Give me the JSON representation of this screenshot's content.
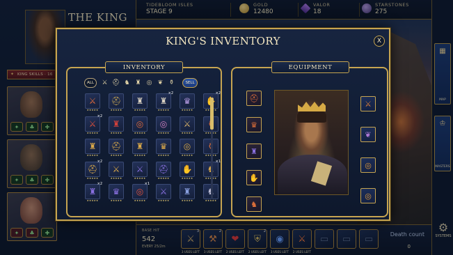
{
  "top_bar": {
    "region_label": "TIDEBLOOM ISLES",
    "stage": "STAGE 9",
    "gold_label": "GOLD",
    "gold_value": "12480",
    "valor_label": "VALOR",
    "valor_value": "18",
    "starstones_label": "STARSTONES",
    "starstones_value": "275"
  },
  "left_panel": {
    "title": "THE KING",
    "skills_tab": "KING SKILLS · 16"
  },
  "modal": {
    "title": "KING'S INVENTORY",
    "close_glyph": "X",
    "inventory_header": "INVENTORY",
    "equipment_header": "EQUIPMENT",
    "filter_all": "ALL",
    "filter_sell": "SELL",
    "filter_icons": [
      "sword-icon",
      "helmet-icon",
      "boots-icon",
      "armor-icon",
      "ring-icon",
      "amulet-icon",
      "potion-icon"
    ],
    "inventory_items": [
      {
        "icon": "sword-icon",
        "glyph": "⚔",
        "color": "#e06a3a",
        "qty": "",
        "stars": "★★★★★"
      },
      {
        "icon": "helmet-icon",
        "glyph": "⛑",
        "color": "#c7a551",
        "qty": "",
        "stars": "★★★★★"
      },
      {
        "icon": "armor-icon",
        "glyph": "♜",
        "color": "#d8d0c0",
        "qty": "",
        "stars": "★★★★★"
      },
      {
        "icon": "armor-icon",
        "glyph": "♜",
        "color": "#d8d0c0",
        "qty": "2",
        "stars": "★★★★★"
      },
      {
        "icon": "chestplate-icon",
        "glyph": "♛",
        "color": "#b49ae0",
        "qty": "",
        "stars": "★★★★★"
      },
      {
        "icon": "gauntlet-icon",
        "glyph": "✋",
        "color": "#d8d0c0",
        "qty": "2",
        "stars": "★★★★★"
      },
      {
        "icon": "sword-icon",
        "glyph": "⚔",
        "color": "#e0503a",
        "qty": "2",
        "stars": "★★★★★"
      },
      {
        "icon": "armor-icon",
        "glyph": "♜",
        "color": "#d0403a",
        "qty": "",
        "stars": "★★★★★"
      },
      {
        "icon": "ring-icon",
        "glyph": "◎",
        "color": "#e06a3a",
        "qty": "",
        "stars": "★★★★★"
      },
      {
        "icon": "ring-icon",
        "glyph": "◎",
        "color": "#d080c0",
        "qty": "",
        "stars": "★★★★★"
      },
      {
        "icon": "sword-icon",
        "glyph": "⚔",
        "color": "#d9b36a",
        "qty": "",
        "stars": "★★★★★"
      },
      {
        "icon": "potion-icon",
        "glyph": "⚱",
        "color": "#e0703a",
        "qty": "",
        "stars": "★★★★★"
      },
      {
        "icon": "armor-icon",
        "glyph": "♜",
        "color": "#d9a84a",
        "qty": "",
        "stars": "★★★★★"
      },
      {
        "icon": "helmet-icon",
        "glyph": "⛑",
        "color": "#d9a84a",
        "qty": "",
        "stars": "★★★★★"
      },
      {
        "icon": "armor-icon",
        "glyph": "♜",
        "color": "#d9a84a",
        "qty": "",
        "stars": "★★★★★"
      },
      {
        "icon": "chestplate-icon",
        "glyph": "♛",
        "color": "#d9a84a",
        "qty": "",
        "stars": "★★★★★"
      },
      {
        "icon": "ring-icon",
        "glyph": "◎",
        "color": "#d9a84a",
        "qty": "",
        "stars": "★★★★★"
      },
      {
        "icon": "potion-icon",
        "glyph": "⚱",
        "color": "#e0703a",
        "qty": "",
        "stars": "★★★★★"
      },
      {
        "icon": "helmet-icon",
        "glyph": "⛑",
        "color": "#d9a84a",
        "qty": "2",
        "stars": "★★★★★"
      },
      {
        "icon": "sword-icon",
        "glyph": "⚔",
        "color": "#d9a84a",
        "qty": "",
        "stars": "★★★★★"
      },
      {
        "icon": "sword-icon",
        "glyph": "⚔",
        "color": "#8a70e0",
        "qty": "",
        "stars": "★★★★★"
      },
      {
        "icon": "helmet-icon",
        "glyph": "⛑",
        "color": "#8a70e0",
        "qty": "",
        "stars": "★★★★★"
      },
      {
        "icon": "gauntlet-icon",
        "glyph": "✋",
        "color": "#e0a04a",
        "qty": "",
        "stars": "★★★★★"
      },
      {
        "icon": "boots-icon",
        "glyph": "♞",
        "color": "#d9a84a",
        "qty": "1",
        "stars": "★★★★★"
      },
      {
        "icon": "armor-icon",
        "glyph": "♜",
        "color": "#8a70e0",
        "qty": "2",
        "stars": "★★★★★"
      },
      {
        "icon": "chestplate-icon",
        "glyph": "♛",
        "color": "#8a70e0",
        "qty": "",
        "stars": "★★★★★"
      },
      {
        "icon": "ring-icon",
        "glyph": "◎",
        "color": "#e0503a",
        "qty": "1",
        "stars": "★★★★★"
      },
      {
        "icon": "sword-icon",
        "glyph": "⚔",
        "color": "#8a70e0",
        "qty": "",
        "stars": "★★★★★"
      },
      {
        "icon": "armor-icon",
        "glyph": "♜",
        "color": "#8aa0e0",
        "qty": "",
        "stars": "★★★★★"
      },
      {
        "icon": "boots-icon",
        "glyph": "♞",
        "color": "#c0c0d8",
        "qty": "",
        "stars": "★★★★★"
      }
    ],
    "equipment_left": [
      {
        "icon": "helmet-icon",
        "glyph": "⛑",
        "color": "#e0703a"
      },
      {
        "icon": "chestplate-icon",
        "glyph": "♛",
        "color": "#e0703a"
      },
      {
        "icon": "armor-icon",
        "glyph": "♜",
        "color": "#8a70e0"
      },
      {
        "icon": "gauntlet-icon",
        "glyph": "✋",
        "color": "#8a70e0"
      },
      {
        "icon": "boots-icon",
        "glyph": "♞",
        "color": "#e0703a"
      }
    ],
    "equipment_right": [
      {
        "icon": "sword-icon",
        "glyph": "⚔",
        "color": "#e0803a"
      },
      {
        "icon": "amulet-icon",
        "glyph": "❦",
        "color": "#b07ad8"
      },
      {
        "icon": "ring-icon",
        "glyph": "◎",
        "color": "#e09a3a"
      },
      {
        "icon": "ring-icon",
        "glyph": "◎",
        "color": "#e09a3a"
      }
    ]
  },
  "bottom_bar": {
    "base_hit_label": "BASE HIT",
    "base_hit_value": "542",
    "interval": "EVERY 25/2m",
    "skills": [
      {
        "icon": "sword-icon",
        "glyph": "⚔",
        "color": "#d9b36a",
        "caption": "3 USES LEFT",
        "count": "3"
      },
      {
        "icon": "hammer-icon",
        "glyph": "⚒",
        "color": "#e08a4a",
        "caption": "3 USES LEFT",
        "count": "2"
      },
      {
        "icon": "heart-icon",
        "glyph": "❤",
        "color": "#e03a3a",
        "caption": "2 USES LEFT",
        "count": ""
      },
      {
        "icon": "shield-icon",
        "glyph": "⛨",
        "color": "#e0c060",
        "caption": "2 USES LEFT",
        "count": "2"
      },
      {
        "icon": "orb-icon",
        "glyph": "◉",
        "color": "#6aa0ff",
        "caption": "3 USES LEFT",
        "count": ""
      },
      {
        "icon": "flame-sword-icon",
        "glyph": "⚔",
        "color": "#ff7a3a",
        "caption": "2 USES LEFT",
        "count": ""
      },
      {
        "icon": "empty-slot-icon",
        "glyph": "▭",
        "color": "#5a6a8a",
        "caption": "",
        "count": ""
      },
      {
        "icon": "empty-slot-icon",
        "glyph": "▭",
        "color": "#5a6a8a",
        "caption": "",
        "count": ""
      },
      {
        "icon": "empty-slot-icon",
        "glyph": "▭",
        "color": "#5a6a8a",
        "caption": "",
        "count": ""
      }
    ],
    "death_count_label": "Death count",
    "death_count_value": "0"
  },
  "right_rail": {
    "map_label": "MAP",
    "masters_label": "MASTERS",
    "systems_label": "SYSTEMS"
  }
}
